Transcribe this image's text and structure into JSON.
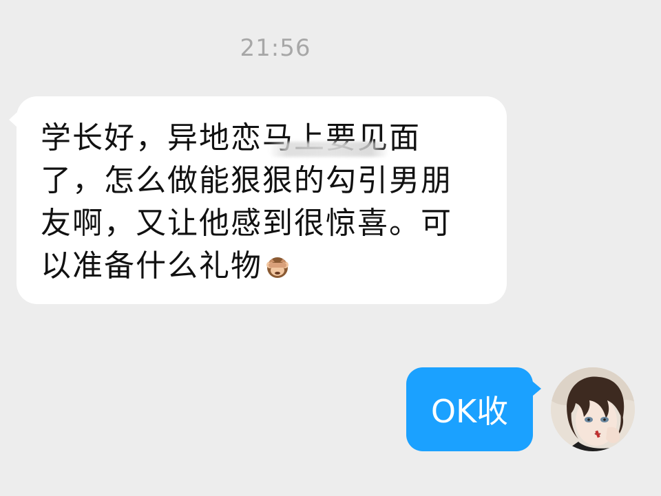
{
  "chat": {
    "timestamp": "21:56",
    "incoming": {
      "text": "学长好，异地恋马上要见面\n了，怎么做能狠狠的勾引男朋\n友啊，又让他感到很惊喜。可\n以准备什么礼物",
      "emoji": "see-no-evil-monkey"
    },
    "outgoing": {
      "text": "OK收"
    }
  },
  "colors": {
    "background": "#ededed",
    "incoming_bubble": "#ffffff",
    "outgoing_bubble": "#1ba1ff",
    "timestamp_text": "#a7a7a7"
  }
}
